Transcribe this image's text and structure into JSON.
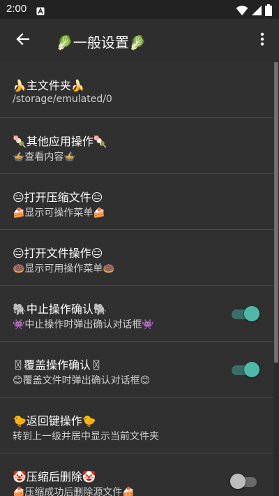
{
  "status_bar": {
    "time": "2:00",
    "notification_icon": "a-box-icon",
    "icons": [
      "wifi-icon",
      "signal-icon",
      "battery-icon"
    ]
  },
  "app_bar": {
    "title": "🥬一般设置🥬",
    "back_icon": "arrow-left-icon",
    "menu_icon": "more-vert-icon"
  },
  "settings": [
    {
      "title": "🍌主文件夹🍌",
      "subtitle": "/storage/emulated/0",
      "toggle": null
    },
    {
      "title": "🍡其他应用操作🍡",
      "subtitle": "🍲查看内容🍲",
      "toggle": null
    },
    {
      "title": "😑打开压缩文件😑",
      "subtitle": "🍰显示可操作菜单🍰",
      "toggle": null
    },
    {
      "title": "😑打开文件操作😑",
      "subtitle": "🍩显示可用操作菜单🍩",
      "toggle": null
    },
    {
      "title": "🐘中止操作确认🐘",
      "subtitle": "👾中止操作时弹出确认对话框👾",
      "toggle": true
    },
    {
      "title": "〿覆盖操作确认〿",
      "subtitle": "😊覆盖文件时弹出确认对话框😊",
      "toggle": true
    },
    {
      "title": "🐤返回键操作🐤",
      "subtitle": "转到上一级并居中显示当前文件夹",
      "toggle": null
    },
    {
      "title": "🤡压缩后删除🤡",
      "subtitle": "🍰压缩成功后删除源文件🍰",
      "toggle": false
    }
  ],
  "colors": {
    "background": "#303030",
    "app_bar": "#2e2e2e",
    "status_bar": "#222222",
    "divider": "#4a4a4a",
    "toggle_on_thumb": "#50b8a8",
    "toggle_on_track": "#3b6e68",
    "toggle_off_thumb": "#bdbdbd",
    "toggle_off_track": "#6a6a6a"
  }
}
